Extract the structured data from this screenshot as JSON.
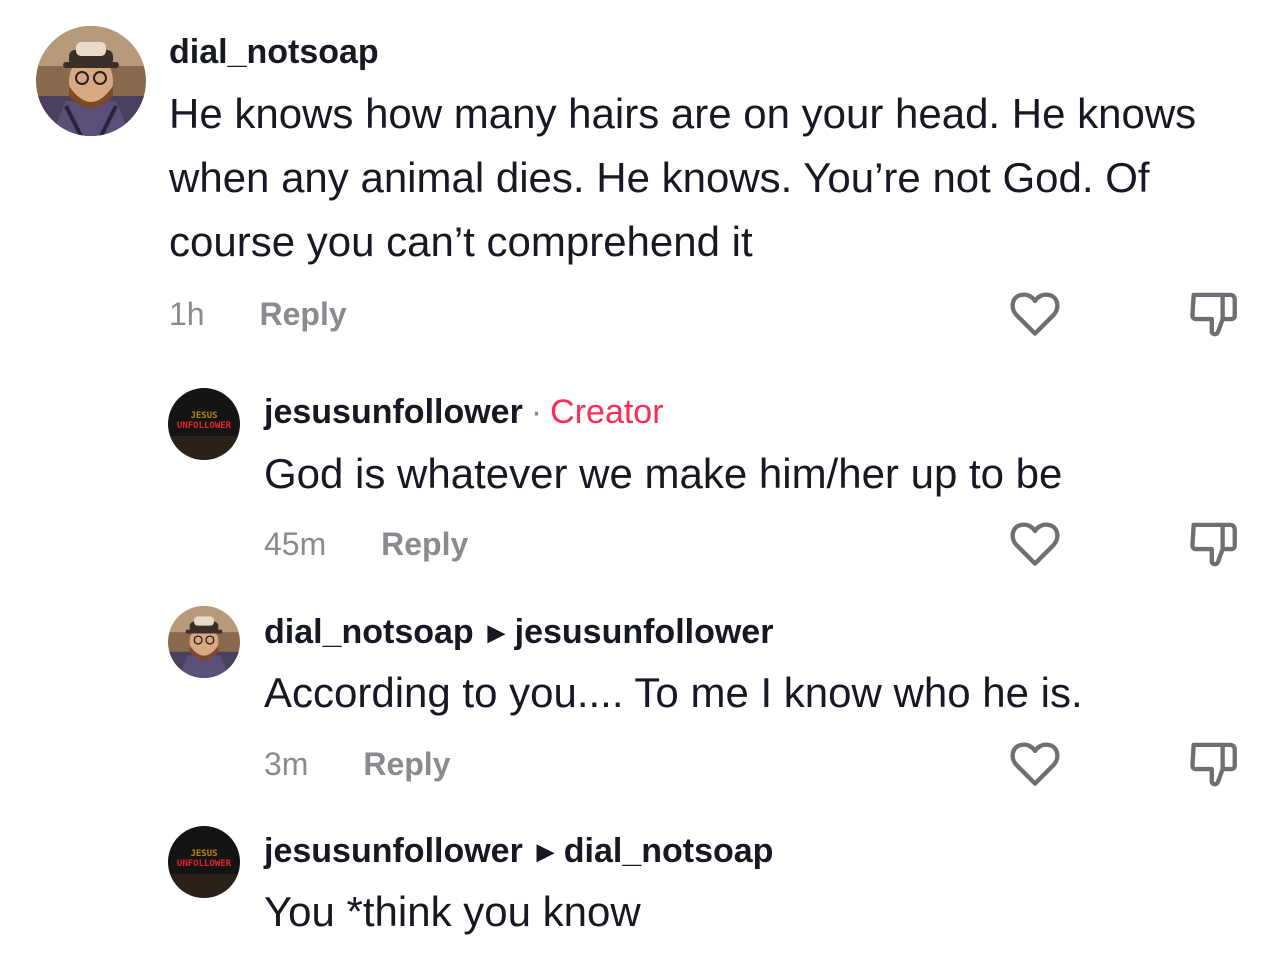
{
  "comments": [
    {
      "username": "dial_notsoap",
      "text": "He knows how many hairs are on your head. He knows when any animal dies. He knows. You’re not God. Of course you can’t comprehend it",
      "time": "1h",
      "reply_label": "Reply",
      "like_icon": "heart-outline-icon",
      "dislike_icon": "thumbs-down-icon"
    },
    {
      "username": "jesusunfollower",
      "separator": "·",
      "badge": "Creator",
      "text": "God is whatever we make him/her up to be",
      "time": "45m",
      "reply_label": "Reply",
      "avatar_text_top": "JESUS",
      "avatar_text_bottom": "UNFOLLOWER"
    },
    {
      "username": "dial_notsoap",
      "reply_to": "jesusunfollower",
      "text": "According to you.... To me I know who he is.",
      "time": "3m",
      "reply_label": "Reply"
    },
    {
      "username": "jesusunfollower",
      "reply_to": "dial_notsoap",
      "text": "You *think you know",
      "avatar_text_top": "JESUS",
      "avatar_text_bottom": "UNFOLLOWER"
    }
  ],
  "colors": {
    "creator": "#fe2c55",
    "muted": "#8a8b91",
    "text": "#161823"
  }
}
